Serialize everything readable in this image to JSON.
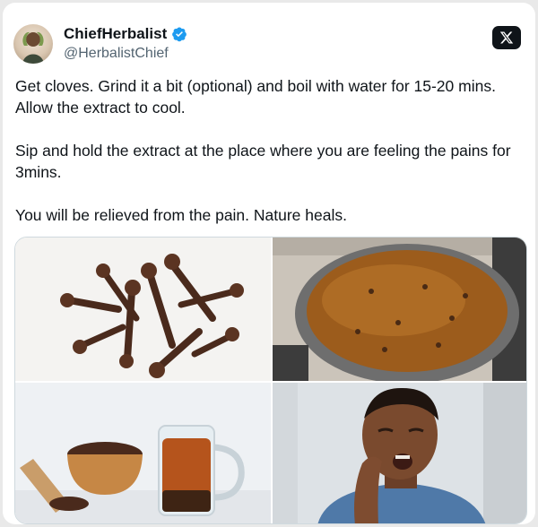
{
  "tweet": {
    "author": {
      "display_name": "ChiefHerbalist",
      "handle": "@HerbalistChief",
      "verified": true,
      "avatar_icon": "avatar-icon"
    },
    "platform_icon": "x-logo-icon",
    "text": [
      "Get cloves. Grind it a bit (optional) and boil with water for 15-20 mins. Allow the extract to cool.",
      "Sip and hold the extract at the place where you are feeling the pains for 3mins.",
      "You will be relieved from the pain. Nature heals."
    ],
    "media": [
      {
        "depicts": "cloves"
      },
      {
        "depicts": "pot-of-clove-extract"
      },
      {
        "depicts": "cloves-bowl-and-tea-mug"
      },
      {
        "depicts": "man-with-toothache"
      }
    ]
  },
  "colors": {
    "text": "#0f1419",
    "secondary": "#536471",
    "verified": "#1d9bf0",
    "background": "#e9e9e9",
    "card": "#ffffff"
  }
}
